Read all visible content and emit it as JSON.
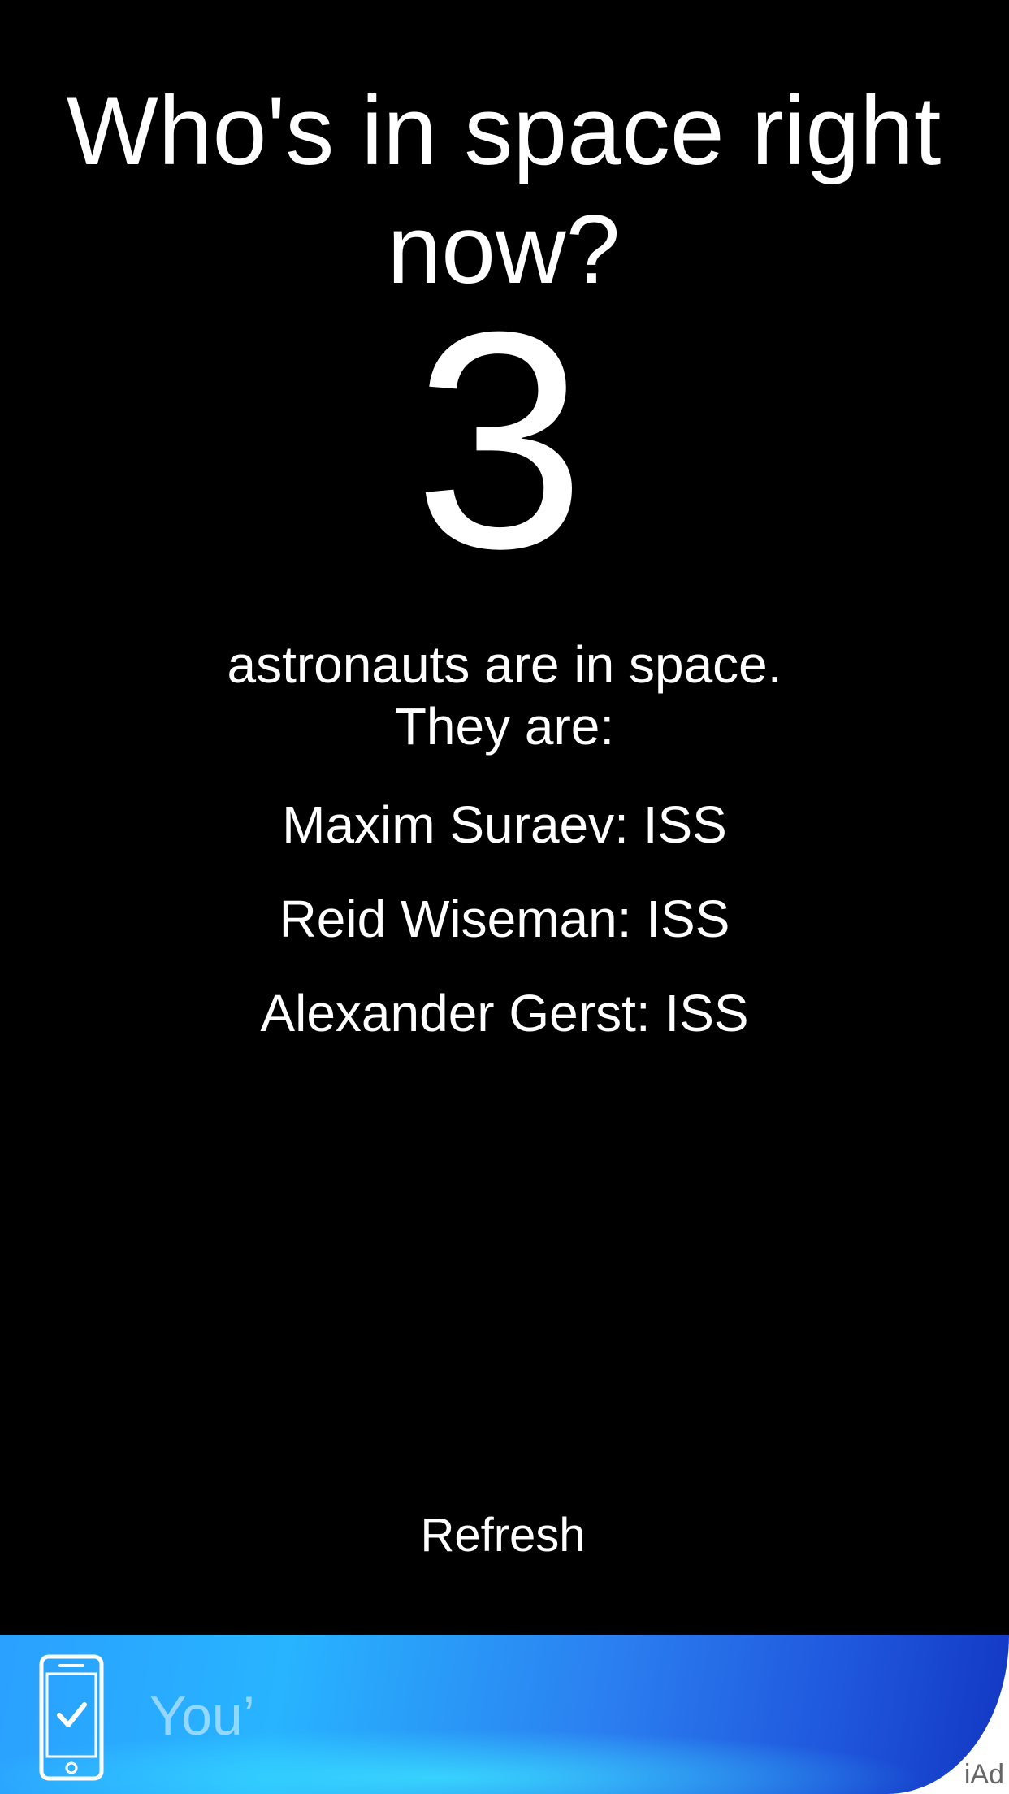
{
  "header": {
    "title": "Who's in space right now?"
  },
  "summary": {
    "count": "3",
    "subtitle_line1": "astronauts are in space.",
    "subtitle_line2": "They are:"
  },
  "astronauts": [
    {
      "text": "Maxim Suraev: ISS"
    },
    {
      "text": "Reid Wiseman: ISS"
    },
    {
      "text": "Alexander Gerst: ISS"
    }
  ],
  "actions": {
    "refresh_label": "Refresh"
  },
  "ad": {
    "text": "You’",
    "badge": "iAd",
    "icon": "phone-check-icon",
    "colors": {
      "gradient_start": "#2aa0ff",
      "gradient_end": "#1236c2"
    }
  },
  "colors": {
    "background": "#000000",
    "text": "#ffffff"
  }
}
